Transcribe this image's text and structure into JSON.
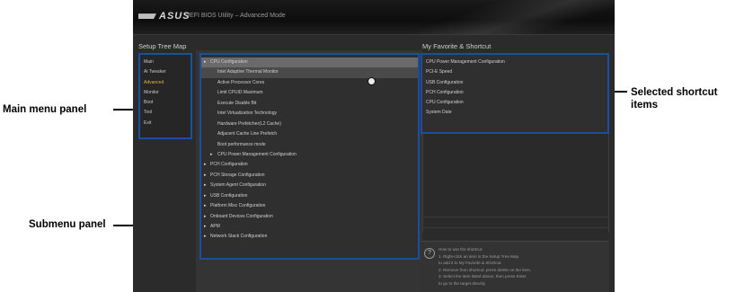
{
  "window": {
    "logo": "ASUS",
    "title": "UEFI BIOS Utility – Advanced Mode"
  },
  "sections": {
    "setup_tree": "Setup Tree Map",
    "favorites": "My Favorite & Shortcut"
  },
  "main_menu": [
    {
      "label": "Main",
      "active": false
    },
    {
      "label": "Ai Tweaker",
      "active": false
    },
    {
      "label": "Advanced",
      "active": true
    },
    {
      "label": "Monitor",
      "active": false
    },
    {
      "label": "Boot",
      "active": false
    },
    {
      "label": "Tool",
      "active": false
    },
    {
      "label": "Exit",
      "active": false
    }
  ],
  "submenu": [
    {
      "label": "CPU Configuration",
      "arrow": true,
      "indent": 0,
      "state": "selected"
    },
    {
      "label": "Intel Adaptive Thermal Monitor",
      "arrow": false,
      "indent": 1,
      "state": "hl"
    },
    {
      "label": "Active Processor Cores",
      "arrow": false,
      "indent": 1,
      "state": ""
    },
    {
      "label": "Limit CPUID Maximum",
      "arrow": false,
      "indent": 1,
      "state": ""
    },
    {
      "label": "Execute Disable Bit",
      "arrow": false,
      "indent": 1,
      "state": ""
    },
    {
      "label": "Intel Virtualization Technology",
      "arrow": false,
      "indent": 1,
      "state": ""
    },
    {
      "label": "Hardware Prefetcher(L2 Cache)",
      "arrow": false,
      "indent": 1,
      "state": ""
    },
    {
      "label": "Adjacent Cache Line Prefetch",
      "arrow": false,
      "indent": 1,
      "state": ""
    },
    {
      "label": "Boot performance mode",
      "arrow": false,
      "indent": 1,
      "state": ""
    },
    {
      "label": "CPU Power Management Configuration",
      "arrow": true,
      "indent": 1,
      "state": ""
    },
    {
      "label": "PCH Configuration",
      "arrow": true,
      "indent": 0,
      "state": ""
    },
    {
      "label": "PCH Storage Configuration",
      "arrow": true,
      "indent": 0,
      "state": ""
    },
    {
      "label": "System Agent Configuration",
      "arrow": true,
      "indent": 0,
      "state": ""
    },
    {
      "label": "USB Configuration",
      "arrow": true,
      "indent": 0,
      "state": ""
    },
    {
      "label": "Platform Misc Configuration",
      "arrow": true,
      "indent": 0,
      "state": ""
    },
    {
      "label": "Onboard Devices Configuration",
      "arrow": true,
      "indent": 0,
      "state": ""
    },
    {
      "label": "APM",
      "arrow": true,
      "indent": 0,
      "state": ""
    },
    {
      "label": "Network Stack Configuration",
      "arrow": true,
      "indent": 0,
      "state": ""
    }
  ],
  "favorites": [
    "CPU Power Management Configuration",
    "PCI-E Speed",
    "USB Configuration",
    "PCH Configuration",
    "CPU Configuration",
    "System Date"
  ],
  "help": {
    "icon": "?",
    "lines": [
      "How to use the shortcut:",
      "1. Right-click an item in the Setup Tree Map",
      "   to add it to My Favorite & Shortcut.",
      "2. Remove from shortcut: press delete on the item.",
      "3. Select the item listed above, then press Enter",
      "   to go to the target directly."
    ]
  },
  "callouts": {
    "main_menu": "Main menu panel",
    "submenu": "Submenu panel",
    "shortcut_line1": "Selected shortcut",
    "shortcut_line2": "items"
  },
  "colors": {
    "highlight_border": "#1a4fa0",
    "active_menu": "#d9b44a"
  },
  "icons": {
    "submenu_arrow": "triangle-right-icon",
    "help": "question-circle-icon",
    "cursor": "mouse-cursor-icon"
  }
}
